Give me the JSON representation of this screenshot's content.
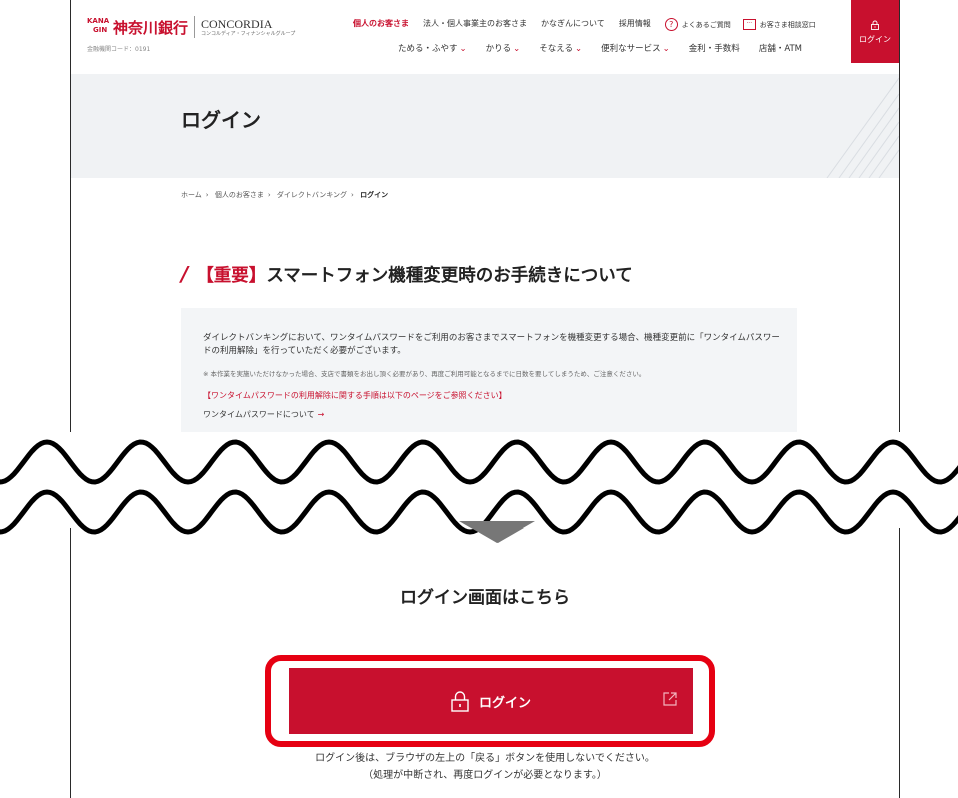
{
  "header": {
    "logo_name": "神奈川銀行",
    "logo_mark": [
      "KANA",
      "GIN"
    ],
    "logo_partner": "CONCORDIA",
    "logo_partner_sub": "コンコルディア・フィナンシャルグループ",
    "bank_code": "金融機関コード：0191",
    "top_nav": [
      "個人のお客さま",
      "法人・個人事業主のお客さま",
      "かなぎんについて",
      "採用情報"
    ],
    "faq": "よくあるご質問",
    "contact": "お客さま相談窓口",
    "sub_nav": [
      {
        "label": "ためる・ふやす",
        "chevron": true
      },
      {
        "label": "かりる",
        "chevron": true
      },
      {
        "label": "そなえる",
        "chevron": true
      },
      {
        "label": "便利なサービス",
        "chevron": true
      },
      {
        "label": "金利・手数料",
        "chevron": false
      },
      {
        "label": "店舗・ATM",
        "chevron": false
      }
    ],
    "login_tab": "ログイン",
    "accent": "#c8102e"
  },
  "hero": {
    "title": "ログイン"
  },
  "breadcrumb": [
    "ホーム",
    "個人のお客さま",
    "ダイレクトバンキング",
    "ログイン"
  ],
  "notice": {
    "title_important": "【重要】",
    "title_rest": "スマートフォン機種変更時のお手続きについて",
    "body": "ダイレクトバンキングにおいて、ワンタイムパスワードをご利用のお客さまでスマートフォンを機種変更する場合、機種変更前に「ワンタイムパスワードの利用解除」を行っていただく必要がございます。",
    "small_note": "※ 本作業を実施いただけなかった場合、支店で書類をお出し頂く必要があり、再度ご利用可能となるまでに日数を要してしまうため、ご注意ください。",
    "red_line": "【ワンタイムパスワードの利用解除に関する手順は以下のページをご参照ください】",
    "link": "ワンタイムパスワードについて"
  },
  "login_section": {
    "title": "ログイン画面はこちら",
    "button": "ログイン",
    "note_line1": "ログイン後は、ブラウザの左上の「戻る」ボタンを使用しないでください。",
    "note_line2": "（処理が中断され、再度ログインが必要となります。）"
  }
}
